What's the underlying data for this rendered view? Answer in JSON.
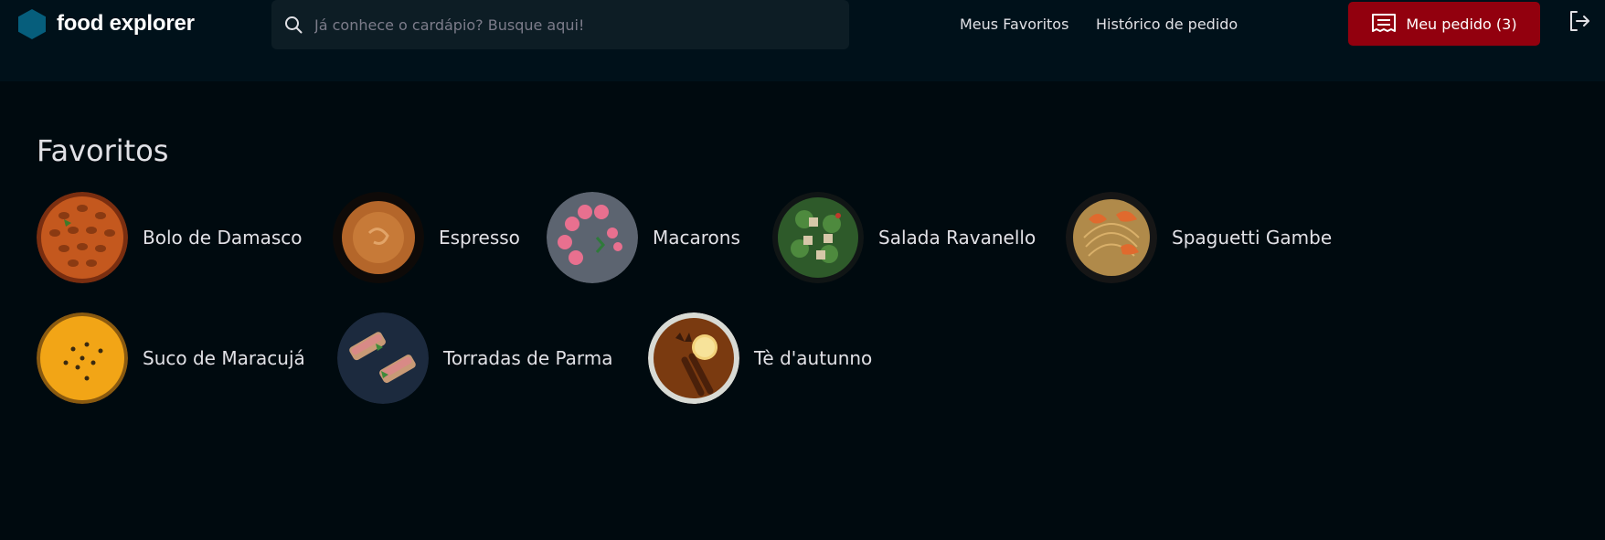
{
  "header": {
    "brand": "food explorer",
    "search_placeholder": "Já conhece o cardápio? Busque aqui!",
    "favorites_link": "Meus Favoritos",
    "history_link": "Histórico de pedido",
    "order_button": "Meu pedido (3)"
  },
  "colors": {
    "background": "#000A0F",
    "header": "#00111A",
    "search": "#0D1D25",
    "accent": "#92000E",
    "logo": "#065E7C"
  },
  "main": {
    "title": "Favoritos",
    "favorites": [
      {
        "name": "Bolo de Damasco"
      },
      {
        "name": "Espresso"
      },
      {
        "name": "Macarons"
      },
      {
        "name": "Salada Ravanello"
      },
      {
        "name": "Spaguetti Gambe"
      },
      {
        "name": "Suco de Maracujá"
      },
      {
        "name": "Torradas de Parma"
      },
      {
        "name": "Tè d'autunno"
      }
    ]
  }
}
